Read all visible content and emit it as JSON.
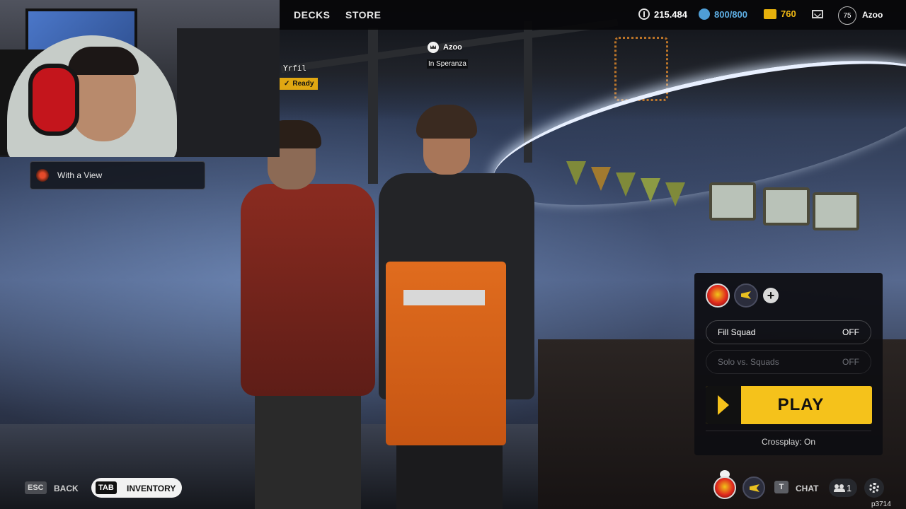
{
  "nav": {
    "decks": "DECKS",
    "store": "STORE"
  },
  "currencies": {
    "coins": {
      "value": "215.484",
      "icon": "coin-icon"
    },
    "energy": {
      "value": "800/800",
      "icon": "energy-icon",
      "color": "#4f9ed6"
    },
    "bullets": {
      "value": "760",
      "icon": "bullets-icon",
      "color": "#e7b10c"
    }
  },
  "profile": {
    "level": "75",
    "username": "Azoo"
  },
  "party": {
    "leader_name": "Azoo",
    "leader_location": "In Speranza",
    "member_name": "Yrfil",
    "member_status": "Ready"
  },
  "deck": {
    "name": "With a View"
  },
  "play_panel": {
    "fill_squad": {
      "label": "Fill Squad",
      "value": "OFF"
    },
    "solo_vs_squads": {
      "label": "Solo vs. Squads",
      "value": "OFF"
    },
    "play_label": "PLAY",
    "crossplay": "Crossplay: On",
    "accent_color": "#f5c21b"
  },
  "bottom": {
    "esc_key": "ESC",
    "back_label": "BACK",
    "tab_key": "TAB",
    "inventory_label": "INVENTORY",
    "chat_key": "T",
    "chat_label": "CHAT",
    "friends_count": "1",
    "session_id": "p3714"
  }
}
